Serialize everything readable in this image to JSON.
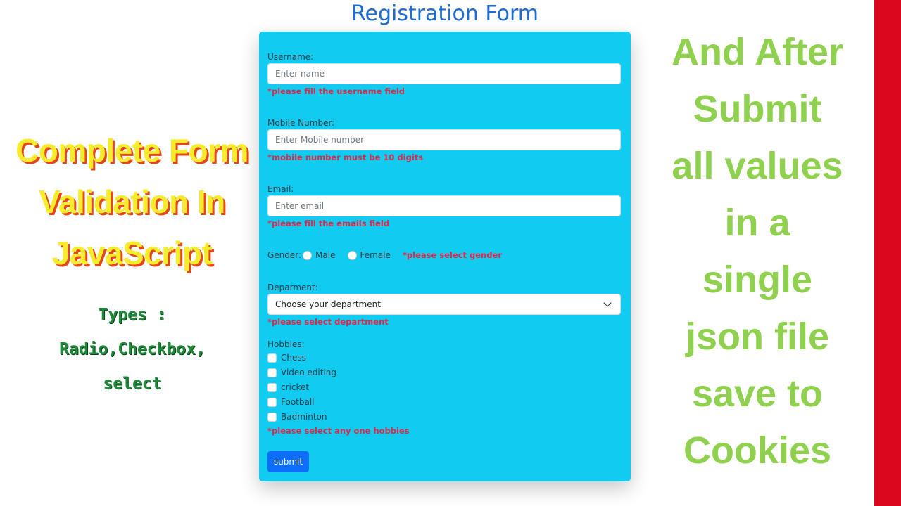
{
  "form": {
    "title": "Registration Form",
    "username": {
      "label": "Username:",
      "placeholder": "Enter name",
      "error": "*please fill the username field"
    },
    "mobile": {
      "label": "Mobile Number:",
      "placeholder": "Enter Mobile number",
      "error": "*mobile number must be 10 digits"
    },
    "email": {
      "label": "Email:",
      "placeholder": "Enter email",
      "error": "*please fill the emails field"
    },
    "gender": {
      "label": "Gender:",
      "options": [
        "Male",
        "Female"
      ],
      "error": "*please select gender"
    },
    "department": {
      "label": "Deparment:",
      "selected": "Choose your department",
      "error": "*please select department"
    },
    "hobbies": {
      "label": "Hobbies:",
      "items": [
        "Chess",
        "Video editing",
        "cricket",
        "Football",
        "Badminton"
      ],
      "error": "*please select any one hobbies"
    },
    "submit_label": "submit"
  },
  "left_panel": {
    "title_lines": [
      "Complete Form",
      "Validation In",
      "JavaScript"
    ],
    "subtitle_lines": [
      "Types :",
      "Radio,Checkbox,",
      "select"
    ]
  },
  "right_panel": {
    "lines": [
      "And After",
      "Submit",
      "all values",
      "in a",
      "single",
      "json file",
      "save to",
      "Cookies"
    ]
  },
  "colors": {
    "form_bg": "#12cbf0",
    "title_blue": "#1c6bd6",
    "error_red": "#e0284a",
    "submit_blue": "#0d6efd",
    "left_title_yellow": "#f7ec2c",
    "left_title_shadow": "#e4471c",
    "left_sub_green": "#1f8a3a",
    "right_text_green": "#8fd14f",
    "side_bar_red": "#d9081f"
  }
}
